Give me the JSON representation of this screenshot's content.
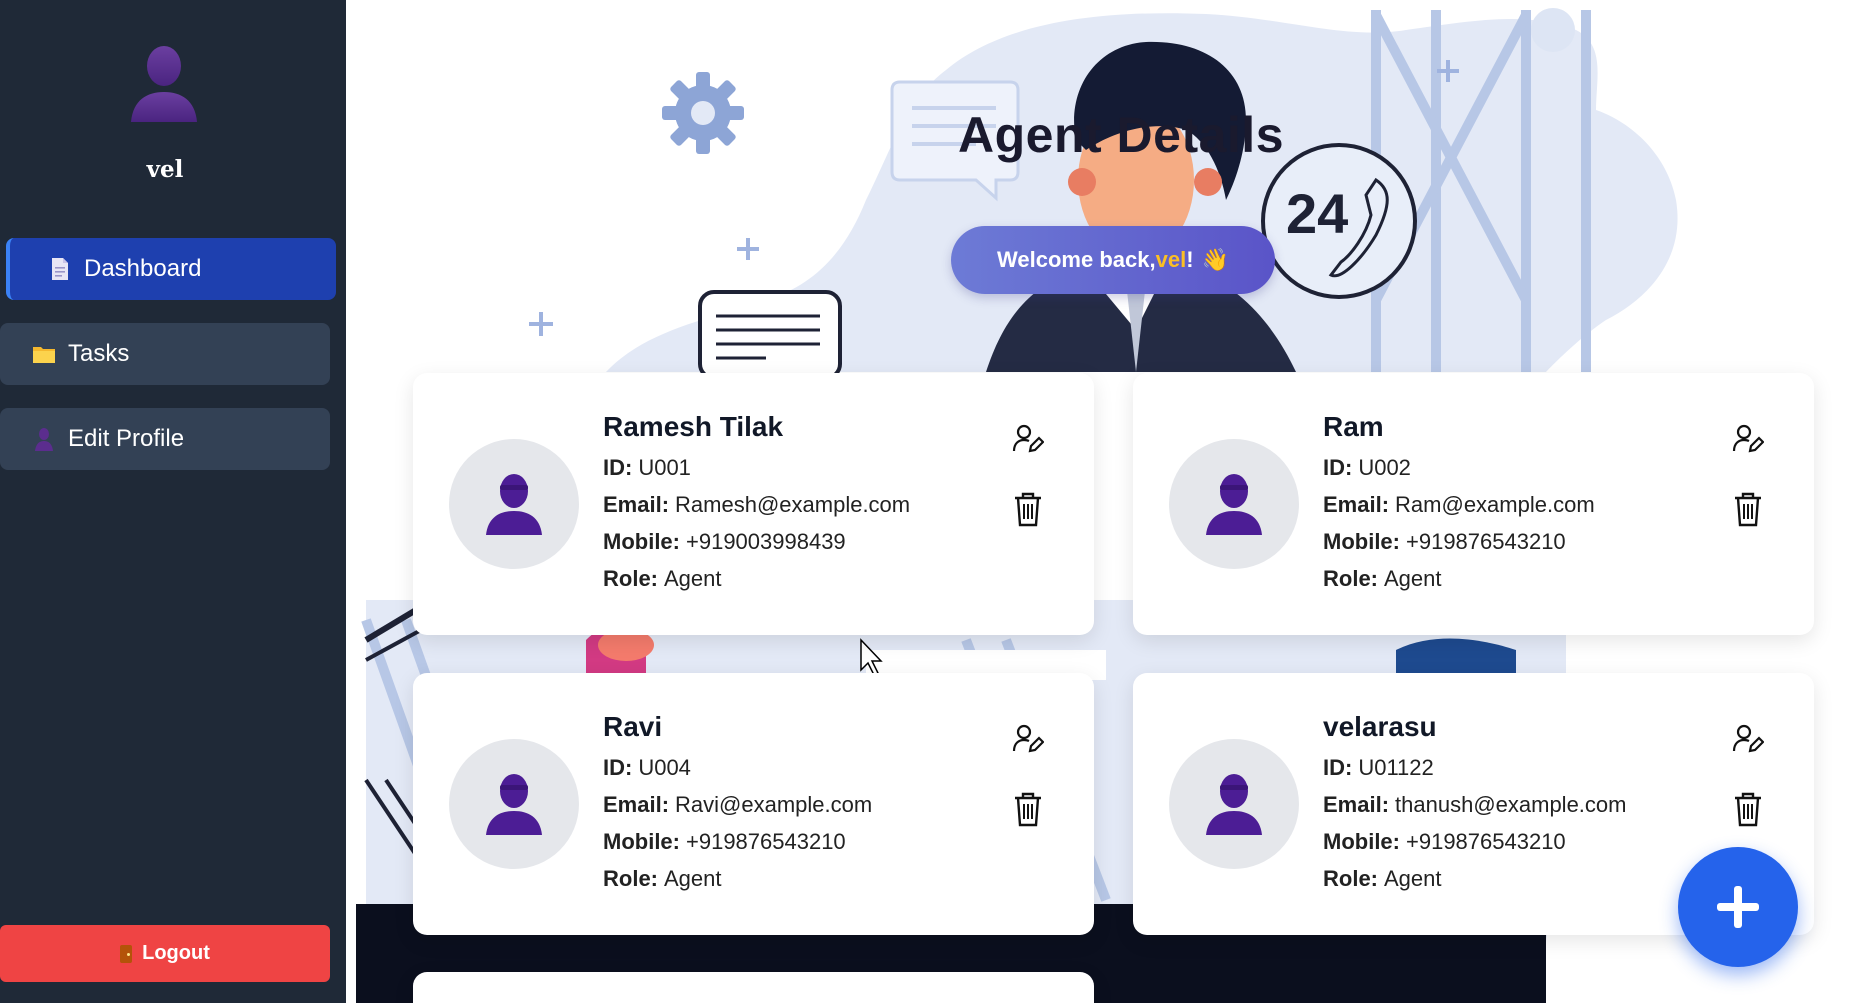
{
  "sidebar": {
    "username": "vel",
    "items": [
      {
        "label": "Dashboard",
        "icon": "document-icon",
        "active": true
      },
      {
        "label": "Tasks",
        "icon": "folder-icon",
        "active": false
      },
      {
        "label": "Edit Profile",
        "icon": "user-icon",
        "active": false
      }
    ],
    "logout_label": "Logout"
  },
  "header": {
    "title": "Agent Details",
    "welcome_prefix": "Welcome back, ",
    "welcome_name": "vel",
    "welcome_suffix": "!",
    "welcome_emoji": "👋"
  },
  "labels": {
    "id": "ID:",
    "email": "Email:",
    "mobile": "Mobile:",
    "role": "Role:"
  },
  "agents": [
    {
      "name": "Ramesh Tilak",
      "id": "U001",
      "email": "Ramesh@example.com",
      "mobile": "+919003998439",
      "role": "Agent"
    },
    {
      "name": "Ram",
      "id": "U002",
      "email": "Ram@example.com",
      "mobile": "+919876543210",
      "role": "Agent"
    },
    {
      "name": "Ravi",
      "id": "U004",
      "email": "Ravi@example.com",
      "mobile": "+919876543210",
      "role": "Agent"
    },
    {
      "name": "velarasu",
      "id": "U01122",
      "email": "thanush@example.com",
      "mobile": "+919876543210",
      "role": "Agent"
    }
  ],
  "illustration_text": {
    "badge_24": "24"
  },
  "colors": {
    "sidebar_bg": "#1f2937",
    "nav_active": "#1e40af",
    "nav_item": "#334155",
    "logout": "#ef4444",
    "fab": "#2563eb",
    "avatar_purple": "#4c1d95",
    "welcome_name": "#fbbf24"
  },
  "icons": {
    "edit": "user-edit-icon",
    "delete": "trash-icon",
    "add": "plus-icon"
  }
}
